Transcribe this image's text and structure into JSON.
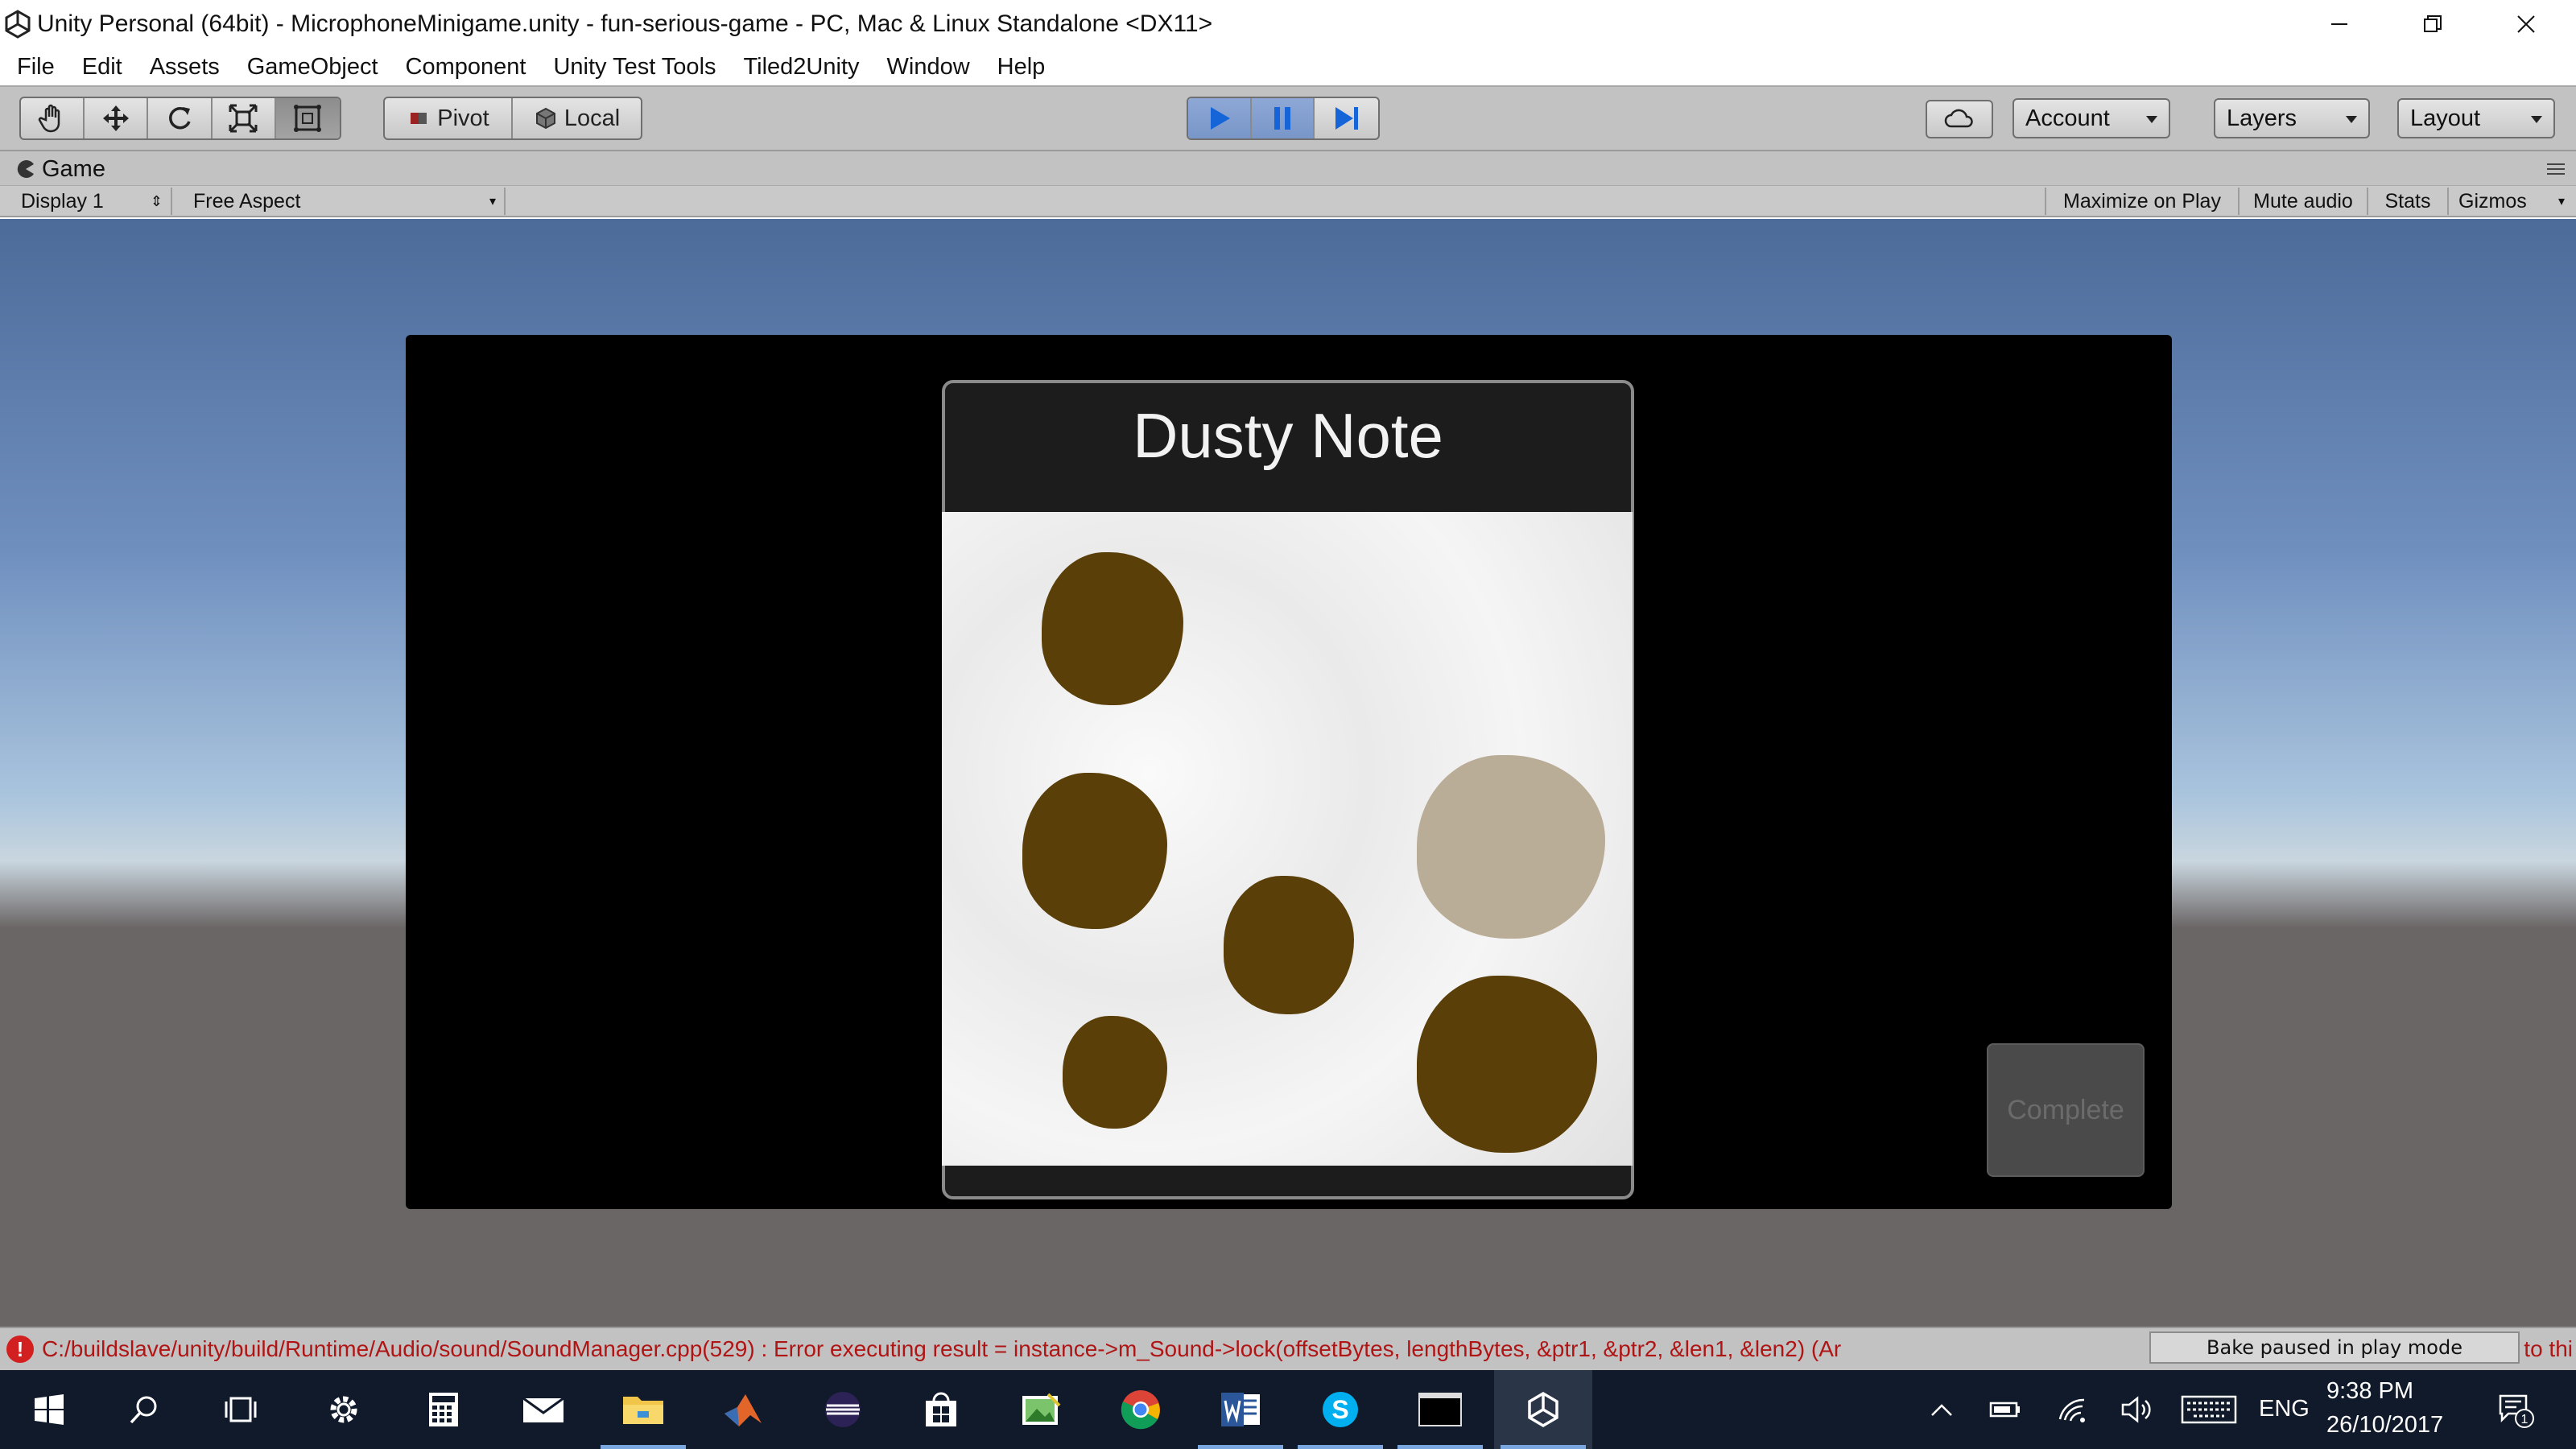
{
  "window": {
    "title": "Unity Personal (64bit) - MicrophoneMinigame.unity - fun-serious-game - PC, Mac & Linux Standalone <DX11>"
  },
  "menu": [
    "File",
    "Edit",
    "Assets",
    "GameObject",
    "Component",
    "Unity Test Tools",
    "Tiled2Unity",
    "Window",
    "Help"
  ],
  "toolbar": {
    "pivot_label": "Pivot",
    "local_label": "Local",
    "account_label": "Account",
    "layers_label": "Layers",
    "layout_label": "Layout"
  },
  "game_view": {
    "tab_label": "Game",
    "display_label": "Display 1",
    "aspect_label": "Free Aspect",
    "maximize_label": "Maximize on Play",
    "mute_label": "Mute audio",
    "stats_label": "Stats",
    "gizmos_label": "Gizmos"
  },
  "game": {
    "note_title": "Dusty Note",
    "complete_label": "Complete",
    "colors": {
      "dust_dark": "#5a3f08",
      "dust_light": "#b9ad97",
      "panel": "#1c1c1c",
      "button": "#4a4a4a"
    }
  },
  "status": {
    "message": "C:/buildslave/unity/build/Runtime/Audio/sound/SoundManager.cpp(529) : Error executing result = instance->m_Sound->lock(offsetBytes, lengthBytes, &ptr1, &ptr2, &len1, &len2) (Ar",
    "bake_label": "Bake paused in play mode",
    "tail": "to thi"
  },
  "taskbar": {
    "apps": [
      "windows-start",
      "search",
      "task-view",
      "settings",
      "calculator",
      "mail",
      "file-explorer",
      "matlab",
      "eclipse",
      "store",
      "photos",
      "chrome",
      "word",
      "skype",
      "terminal",
      "unity"
    ],
    "language": "ENG",
    "time": "9:38 PM",
    "date": "26/10/2017",
    "notification_count": "1"
  }
}
